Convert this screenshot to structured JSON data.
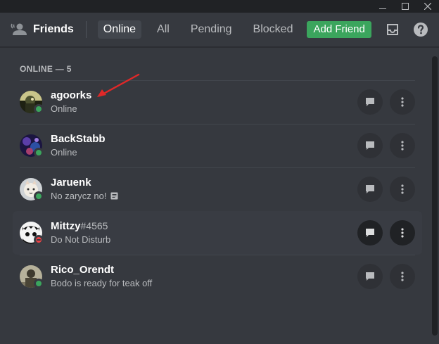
{
  "header": {
    "title": "Friends",
    "tabs": [
      "Online",
      "All",
      "Pending",
      "Blocked"
    ],
    "active_tab": "Online",
    "add_friend_label": "Add Friend"
  },
  "section": {
    "label": "ONLINE — 5"
  },
  "friends": [
    {
      "name": "agoorks",
      "discriminator": "",
      "status_text": "Online",
      "status": "online",
      "note_icon": false
    },
    {
      "name": "BackStabb",
      "discriminator": "",
      "status_text": "Online",
      "status": "online",
      "note_icon": false
    },
    {
      "name": "Jaruenk",
      "discriminator": "",
      "status_text": "No zarycz no!",
      "status": "online",
      "note_icon": true
    },
    {
      "name": "Mittzy",
      "discriminator": "#4565",
      "status_text": "Do Not Disturb",
      "status": "dnd",
      "note_icon": false
    },
    {
      "name": "Rico_Orendt",
      "discriminator": "",
      "status_text": "Bodo is ready for teak off",
      "status": "online",
      "note_icon": false
    }
  ],
  "colors": {
    "online": "#3ba55d",
    "dnd": "#ed4245",
    "add_friend": "#3ba55d",
    "annotation_arrow": "#e02828"
  },
  "icons": [
    "friends-wave-icon",
    "inbox-icon",
    "help-icon",
    "message-icon",
    "more-vertical-icon",
    "custom-status-note-icon"
  ]
}
